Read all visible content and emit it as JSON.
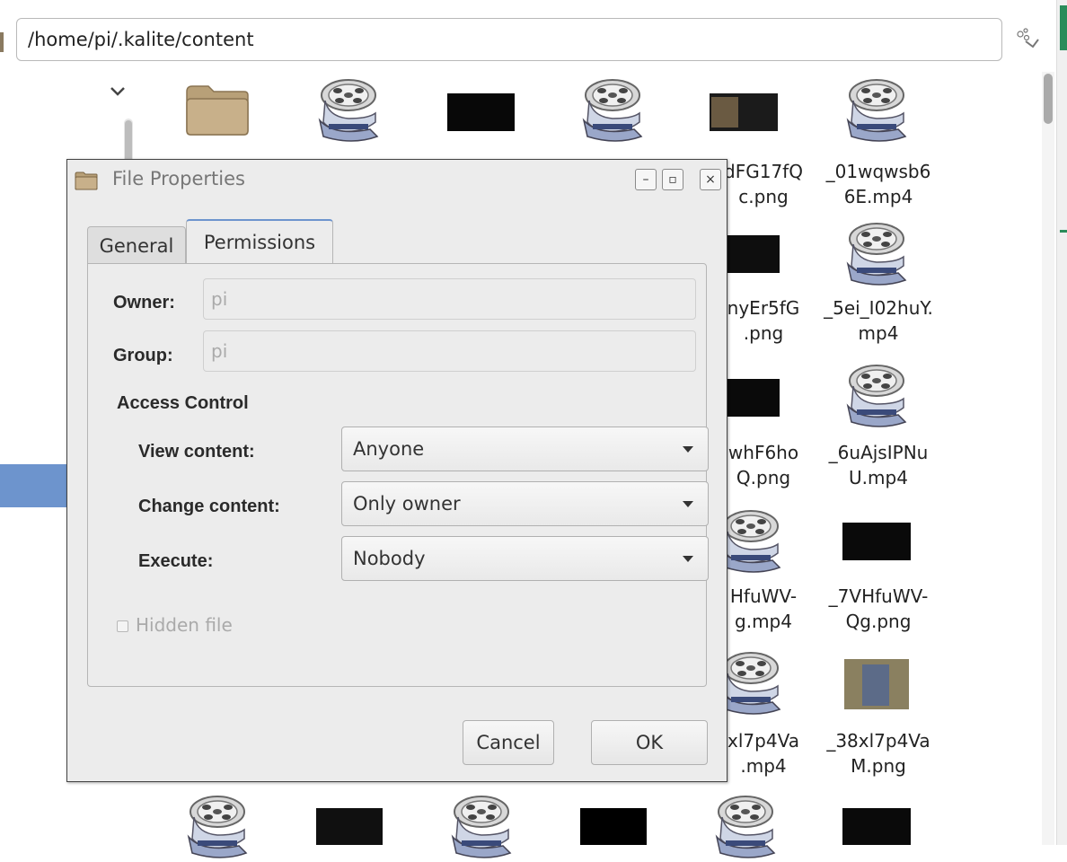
{
  "location_bar": {
    "path": "/home/pi/.kalite/content"
  },
  "file_grid": {
    "items": [
      {
        "name_line1": "dFG17fQ",
        "name_line2": "c.png"
      },
      {
        "name_line1": "_01wqwsb6",
        "name_line2": "6E.mp4"
      },
      {
        "name_line1": "nyEr5fG",
        "name_line2": ".png"
      },
      {
        "name_line1": "_5ei_I02huY.",
        "name_line2": "mp4"
      },
      {
        "name_line1": "whF6ho",
        "name_line2": "Q.png"
      },
      {
        "name_line1": "_6uAjsIPNu",
        "name_line2": "U.mp4"
      },
      {
        "name_line1": "HfuWV-",
        "name_line2": "g.mp4"
      },
      {
        "name_line1": "_7VHfuWV-",
        "name_line2": "Qg.png"
      },
      {
        "name_line1": "xl7p4Va",
        "name_line2": ".mp4"
      },
      {
        "name_line1": "_38xl7p4Va",
        "name_line2": "M.png"
      }
    ]
  },
  "dialog": {
    "title": "File Properties",
    "tabs": {
      "general": "General",
      "permissions": "Permissions"
    },
    "owner": {
      "label": "Owner:",
      "value": "pi"
    },
    "group": {
      "label": "Group:",
      "value": "pi"
    },
    "access_control": {
      "heading": "Access Control",
      "view": {
        "label": "View content:",
        "value": "Anyone"
      },
      "change": {
        "label": "Change content:",
        "value": "Only owner"
      },
      "execute": {
        "label": "Execute:",
        "value": "Nobody"
      }
    },
    "hidden_file": {
      "label": "Hidden file",
      "checked": false
    },
    "buttons": {
      "cancel": "Cancel",
      "ok": "OK"
    },
    "window_buttons": {
      "minimize": "–",
      "maximize": "▫",
      "close": "×"
    }
  }
}
